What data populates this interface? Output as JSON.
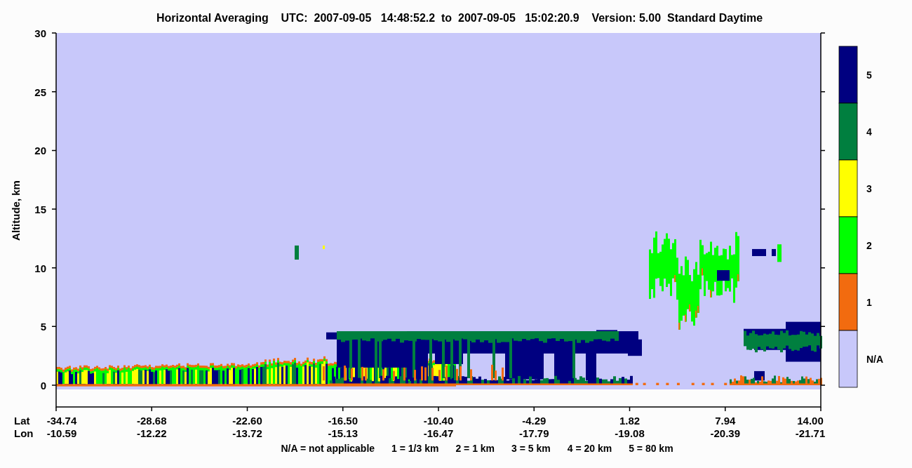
{
  "title": "Horizontal Averaging    UTC:  2007-09-05   14:48:52.2  to  2007-09-05   15:02:20.9    Version: 5.00  Standard Daytime",
  "y_axis": {
    "label": "Altitude, km",
    "ticks": [
      "30",
      "25",
      "20",
      "15",
      "10",
      "5",
      "0"
    ]
  },
  "x_axis": {
    "rows": [
      {
        "label": "Lat",
        "ticks": [
          "-34.74",
          "-28.68",
          "-22.60",
          "-16.50",
          "-10.40",
          "-4.29",
          "1.82",
          "7.94",
          "14.00"
        ]
      },
      {
        "label": "Lon",
        "ticks": [
          "-10.59",
          "-12.22",
          "-13.72",
          "-15.13",
          "-16.47",
          "-17.79",
          "-19.08",
          "-20.39",
          "-21.71"
        ]
      }
    ]
  },
  "colorbar": [
    {
      "label": "5",
      "color": "#000080"
    },
    {
      "label": "4",
      "color": "#007f3f"
    },
    {
      "label": "3",
      "color": "#ffff00"
    },
    {
      "label": "2",
      "color": "#00ff00"
    },
    {
      "label": "1",
      "color": "#f26b0f"
    },
    {
      "label": "N/A",
      "color": "#c8c8fa"
    }
  ],
  "legend": [
    "N/A = not applicable",
    "1 = 1/3 km",
    "2 = 1 km",
    "3 = 5 km",
    "4 = 20 km",
    "5 = 80 km"
  ]
}
